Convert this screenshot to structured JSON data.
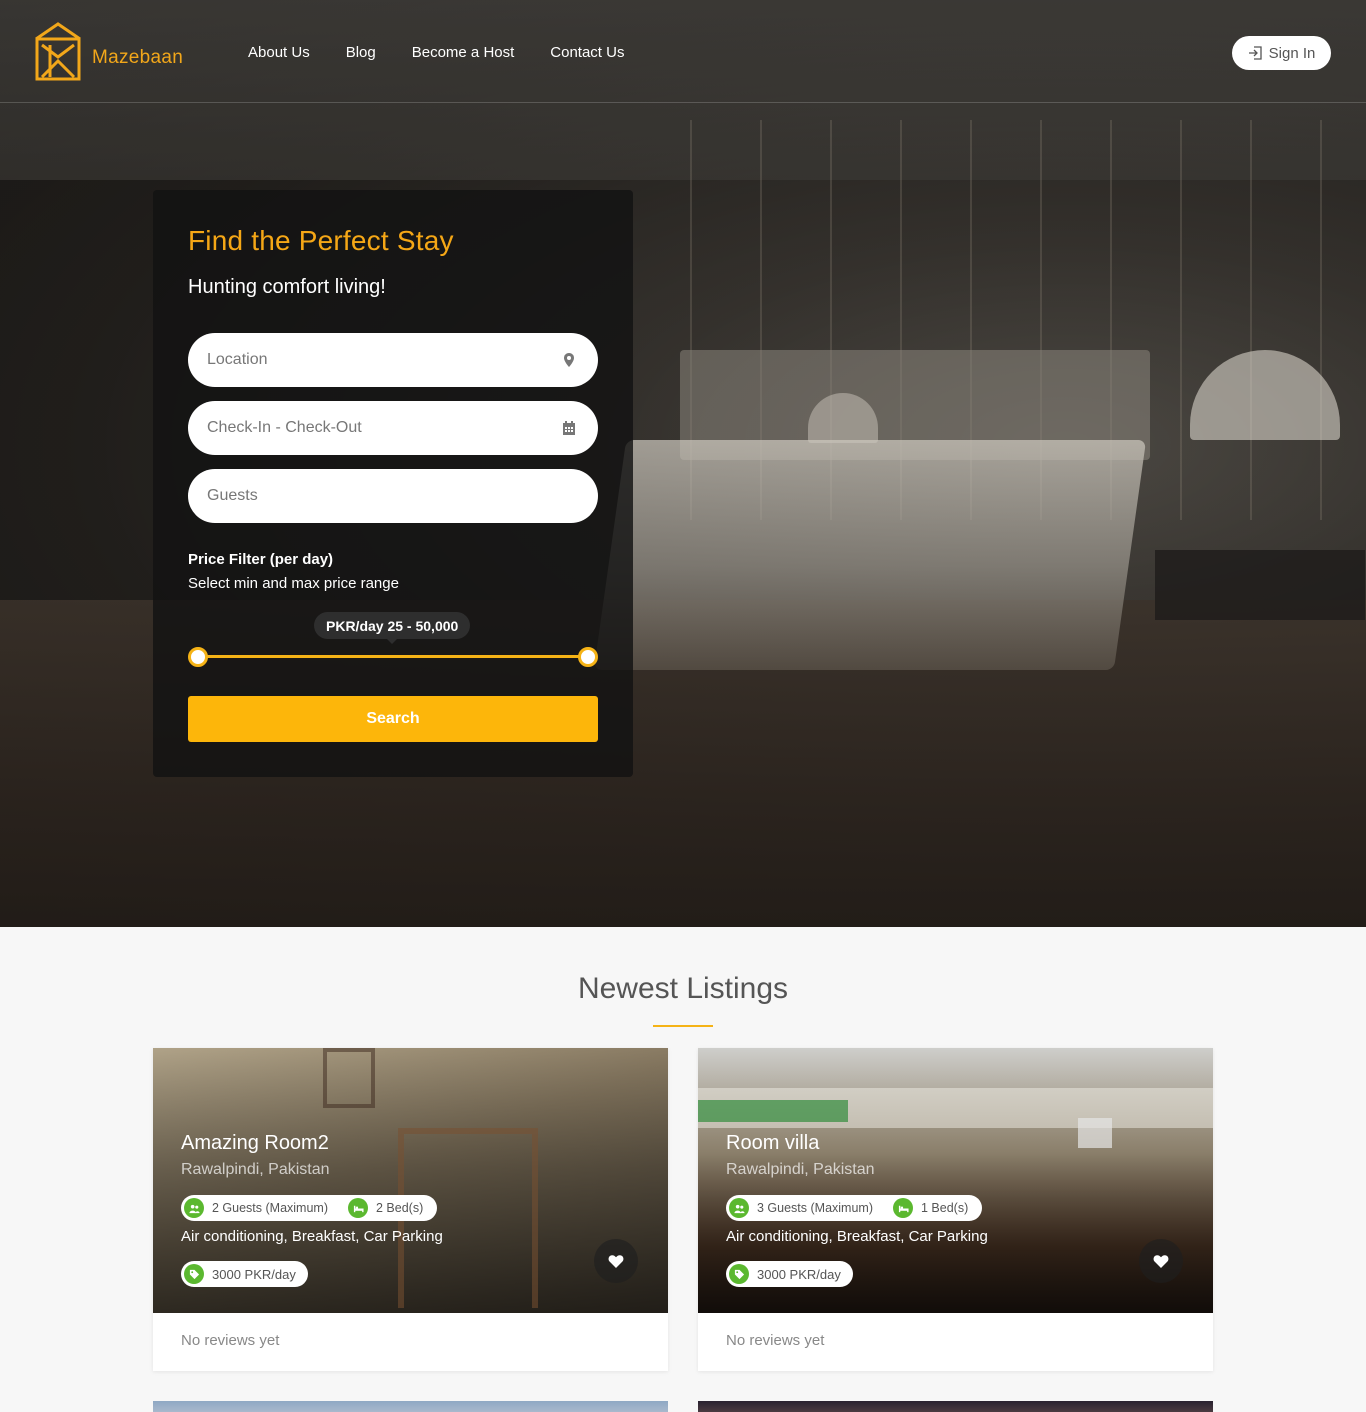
{
  "brand": {
    "name": "Mazebaan",
    "color": "#f2a71a"
  },
  "nav": {
    "items": [
      "About Us",
      "Blog",
      "Become a Host",
      "Contact Us"
    ],
    "signin_label": "Sign In"
  },
  "search": {
    "title": "Find the Perfect Stay",
    "subtitle": "Hunting comfort living!",
    "location_placeholder": "Location",
    "dates_placeholder": "Check-In - Check-Out",
    "guests_placeholder": "Guests",
    "price_filter_title": "Price Filter (per day)",
    "price_filter_sub": "Select min and max price range",
    "price_range_label": "PKR/day 25 - 50,000",
    "price_min": 25,
    "price_max": 50000,
    "button_label": "Search",
    "accent_color": "#fdb60a"
  },
  "listings": {
    "section_title": "Newest Listings",
    "cards": [
      {
        "title": "Amazing Room2",
        "location": "Rawalpindi, Pakistan",
        "guests": "2 Guests (Maximum)",
        "beds": "2 Bed(s)",
        "amenities": "Air conditioning, Breakfast, Car Parking",
        "price": "3000 PKR/day",
        "reviews": "No reviews yet"
      },
      {
        "title": "Room villa",
        "location": "Rawalpindi, Pakistan",
        "guests": "3 Guests (Maximum)",
        "beds": "1 Bed(s)",
        "amenities": "Air conditioning, Breakfast, Car Parking",
        "price": "3000 PKR/day",
        "reviews": "No reviews yet"
      }
    ]
  },
  "icons": {
    "location": "map-pin-icon",
    "calendar": "calendar-icon",
    "guests": "users-icon",
    "beds": "bed-icon",
    "price": "tag-icon",
    "favorite": "heart-icon",
    "signin": "sign-in-icon"
  }
}
